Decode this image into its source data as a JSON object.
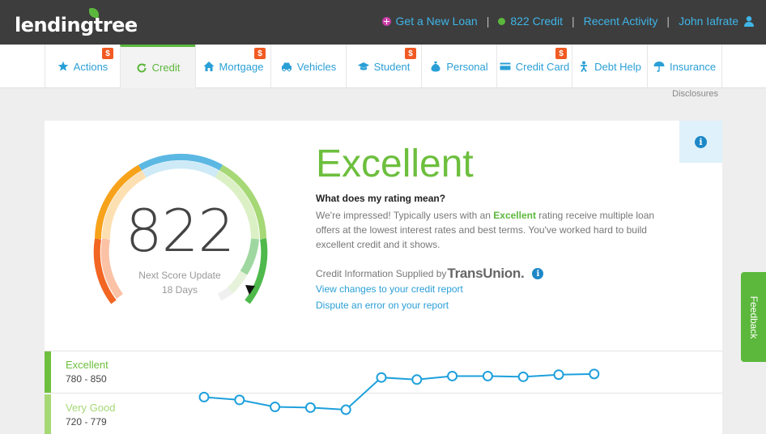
{
  "header": {
    "logo_text": "lendingtree",
    "nav": {
      "new_loan": "Get a New Loan",
      "credit": "822 Credit",
      "recent": "Recent Activity",
      "user": "John Iafrate",
      "separator": "|"
    }
  },
  "tabs": [
    {
      "label": "Actions",
      "icon": "star-icon",
      "badge": "$"
    },
    {
      "label": "Credit",
      "icon": "refresh-icon",
      "badge": ""
    },
    {
      "label": "Mortgage",
      "icon": "house-icon",
      "badge": "$"
    },
    {
      "label": "Vehicles",
      "icon": "car-icon",
      "badge": ""
    },
    {
      "label": "Student",
      "icon": "graduation-cap-icon",
      "badge": "$"
    },
    {
      "label": "Personal",
      "icon": "money-bag-icon",
      "badge": ""
    },
    {
      "label": "Credit Card",
      "icon": "credit-card-icon",
      "badge": "$"
    },
    {
      "label": "Debt Help",
      "icon": "person-icon",
      "badge": ""
    },
    {
      "label": "Insurance",
      "icon": "umbrella-icon",
      "badge": ""
    }
  ],
  "active_tab": "Credit",
  "disclosures": "Disclosures",
  "score_card": {
    "score": "822",
    "next_update_label": "Next Score Update",
    "next_update_days": "18 Days",
    "rating": "Excellent",
    "question": "What does my rating mean?",
    "description_before": "We're impressed! Typically users with an ",
    "description_highlight": "Excellent",
    "description_after": " rating receive multiple loan offers at the lowest interest rates and best terms. You've worked hard to build excellent credit and it shows.",
    "supplied_by": "Credit Information Supplied by",
    "bureau": "TransUnion",
    "bureau_mark": ".",
    "link_changes": "View changes to your credit report",
    "link_dispute": "Dispute an error on your report",
    "info_glyph": "i"
  },
  "history": {
    "bands": [
      {
        "name": "Excellent",
        "range": "780 - 850",
        "color": "#6dbf3e"
      },
      {
        "name": "Very Good",
        "range": "720 - 779",
        "color": "#a6d876"
      }
    ],
    "points": [
      776,
      772,
      762,
      761,
      758,
      804,
      801,
      806,
      806,
      805,
      808,
      809
    ]
  },
  "feedback": "Feedback",
  "colors": {
    "accent_green": "#5cb83c",
    "link_blue": "#2a9fd6",
    "header_bg": "#3d3d3d",
    "badge_orange": "#f15a22"
  }
}
